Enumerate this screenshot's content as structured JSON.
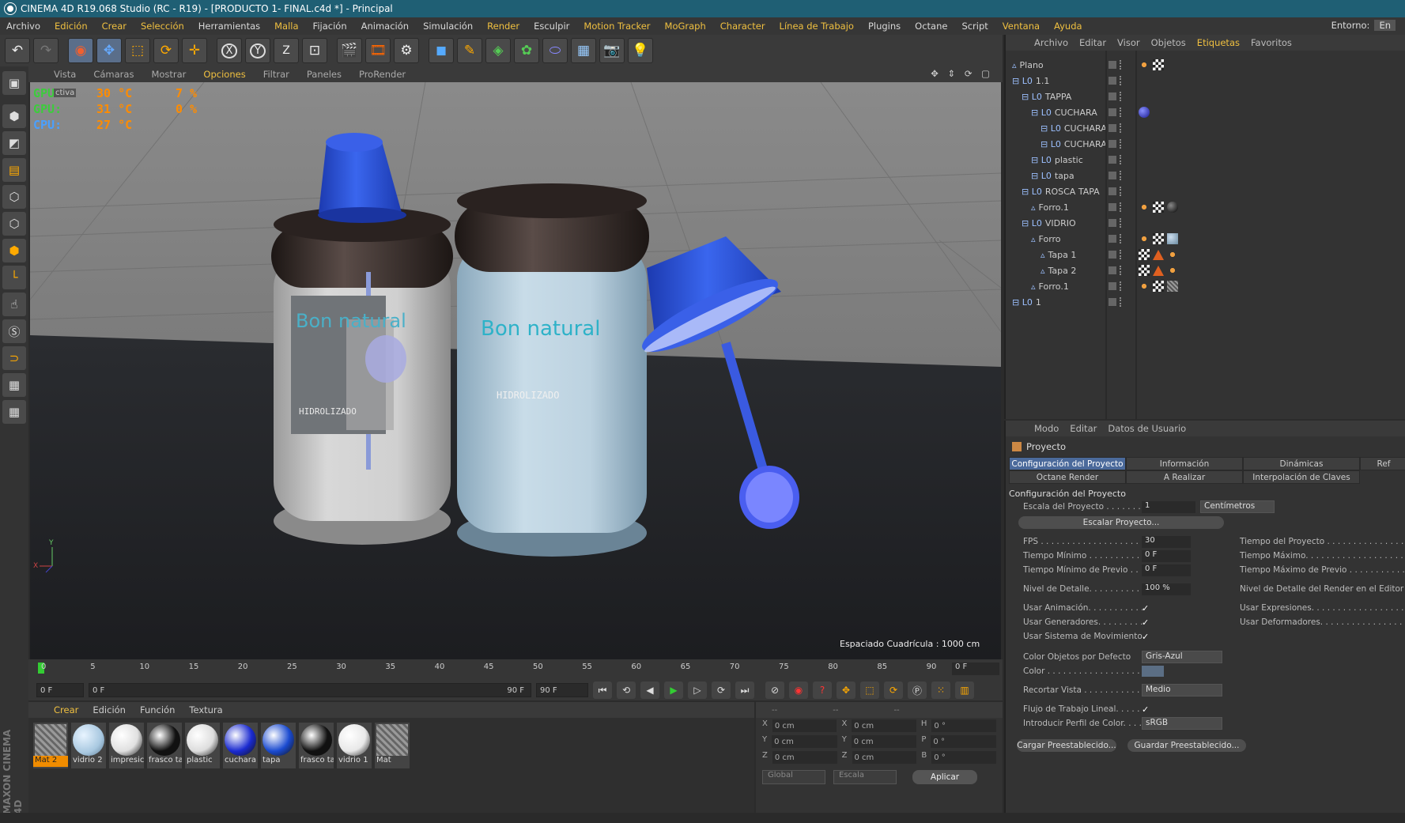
{
  "window": {
    "title": "CINEMA 4D R19.068 Studio (RC - R19) - [PRODUCTO 1- FINAL.c4d *] - Principal"
  },
  "menu": {
    "items": [
      "Archivo",
      "Edición",
      "Crear",
      "Selección",
      "Herramientas",
      "Malla",
      "Fijación",
      "Animación",
      "Simulación",
      "Render",
      "Esculpir",
      "Motion Tracker",
      "MoGraph",
      "Character",
      "Línea de Trabajo",
      "Plugins",
      "Octane",
      "Script",
      "Ventana",
      "Ayuda"
    ],
    "env_label": "Entorno:",
    "env_value": "En"
  },
  "toolbar": {
    "icons": [
      "undo-icon",
      "redo-icon",
      "live-select-icon",
      "move-icon",
      "scale-icon",
      "rotate-icon",
      "last-tool-icon",
      "x-axis-icon",
      "y-axis-icon",
      "z-axis-icon",
      "coordinate-system-icon",
      "render-view-icon",
      "render-picture-viewer-icon",
      "render-settings-icon",
      "cube-icon",
      "pen-icon",
      "subdivision-icon",
      "cloner-icon",
      "deformer-icon",
      "floor-icon",
      "camera-icon",
      "light-icon"
    ],
    "axis_x": "X",
    "axis_y": "Y",
    "axis_z": "Z"
  },
  "viewport": {
    "menu": [
      "Vista",
      "Cámaras",
      "Mostrar",
      "Opciones",
      "Filtrar",
      "Paneles",
      "ProRender"
    ],
    "active_menu": "Opciones",
    "stats": [
      {
        "label": "GPU:",
        "value": "30 °C",
        "extra": "7 %"
      },
      {
        "label": "GPU:",
        "value": "31 °C",
        "extra": "0 %"
      },
      {
        "label": "CPU:",
        "value": "27 °C",
        "extra": ""
      }
    ],
    "grid_spacing": "Espaciado Cuadrícula : 1000 cm",
    "brand_text": "Bon natural",
    "label_text": "HIDROLIZADO",
    "overlay_fragment": "ctiva"
  },
  "timeline": {
    "ticks": [
      "0",
      "5",
      "10",
      "15",
      "20",
      "25",
      "30",
      "35",
      "40",
      "45",
      "50",
      "55",
      "60",
      "65",
      "70",
      "75",
      "80",
      "85",
      "90"
    ],
    "current_frame": "0 F",
    "start_frame": "0 F",
    "range_start": "0 F",
    "range_end": "90 F",
    "end_frame": "90 F"
  },
  "materials": {
    "menu": [
      "Crear",
      "Edición",
      "Función",
      "Textura"
    ],
    "items": [
      {
        "name": "Mat 2",
        "color": "#7a7a7a",
        "style": "hatch",
        "selected": true
      },
      {
        "name": "vidrio 2",
        "color": "#a8c8e0",
        "style": "glass"
      },
      {
        "name": "impresic",
        "color": "#e0e0e0",
        "style": "white"
      },
      {
        "name": "frasco ta",
        "color": "#111111",
        "style": "black"
      },
      {
        "name": "plastic",
        "color": "#dddddd",
        "style": "white"
      },
      {
        "name": "cuchara",
        "color": "#1a2ad0",
        "style": "blue"
      },
      {
        "name": "tapa",
        "color": "#1a4ad0",
        "style": "blue"
      },
      {
        "name": "frasco ta",
        "color": "#111111",
        "style": "black"
      },
      {
        "name": "vidrio 1",
        "color": "#e8e8e8",
        "style": "white"
      },
      {
        "name": "Mat",
        "color": "#7a7a7a",
        "style": "hatch"
      }
    ]
  },
  "coordinates": {
    "header": [
      "--",
      "--",
      "--"
    ],
    "rows": [
      {
        "a": "X",
        "av": "0 cm",
        "b": "X",
        "bv": "0 cm",
        "c": "H",
        "cv": "0 °"
      },
      {
        "a": "Y",
        "av": "0 cm",
        "b": "Y",
        "bv": "0 cm",
        "c": "P",
        "cv": "0 °"
      },
      {
        "a": "Z",
        "av": "0 cm",
        "b": "Z",
        "bv": "0 cm",
        "c": "B",
        "cv": "0 °"
      }
    ],
    "mode1": "Global",
    "mode2": "Escala",
    "apply": "Aplicar"
  },
  "objects": {
    "menu": [
      "Archivo",
      "Editar",
      "Visor",
      "Objetos",
      "Etiquetas",
      "Favoritos"
    ],
    "active_menu": "Etiquetas",
    "tree": [
      {
        "name": "Plano",
        "depth": 0,
        "type": "poly",
        "tags": [
          "phong",
          "checker"
        ]
      },
      {
        "name": "1.1",
        "depth": 0,
        "type": "null",
        "tags": []
      },
      {
        "name": "TAPPA",
        "depth": 1,
        "type": "null",
        "tags": []
      },
      {
        "name": "CUCHARA",
        "depth": 2,
        "type": "null",
        "tags": [
          "ball-blue"
        ]
      },
      {
        "name": "CUCHARA",
        "depth": 3,
        "type": "null",
        "tags": []
      },
      {
        "name": "CUCHARA",
        "depth": 3,
        "type": "null",
        "tags": []
      },
      {
        "name": "plastic",
        "depth": 2,
        "type": "null",
        "tags": []
      },
      {
        "name": "tapa",
        "depth": 2,
        "type": "null",
        "tags": []
      },
      {
        "name": "ROSCA TAPA",
        "depth": 1,
        "type": "null",
        "tags": []
      },
      {
        "name": "Forro.1",
        "depth": 2,
        "type": "poly",
        "tags": [
          "phong",
          "checker",
          "ball-black"
        ]
      },
      {
        "name": "VIDRIO",
        "depth": 1,
        "type": "null",
        "tags": []
      },
      {
        "name": "Forro",
        "depth": 2,
        "type": "poly",
        "tags": [
          "phong",
          "checker",
          "ball-glass"
        ]
      },
      {
        "name": "Tapa 1",
        "depth": 3,
        "type": "poly",
        "tags": [
          "checker",
          "tri",
          "phong"
        ]
      },
      {
        "name": "Tapa 2",
        "depth": 3,
        "type": "poly",
        "tags": [
          "checker",
          "tri",
          "phong"
        ]
      },
      {
        "name": "Forro.1",
        "depth": 2,
        "type": "poly",
        "tags": [
          "phong",
          "checker",
          "hatch"
        ]
      },
      {
        "name": "1",
        "depth": 0,
        "type": "null",
        "tags": []
      }
    ]
  },
  "attributes": {
    "menu": [
      "Modo",
      "Editar",
      "Datos de Usuario"
    ],
    "object": "Proyecto",
    "tabs": [
      "Configuración del Proyecto",
      "Información",
      "Dinámicas",
      "Ref",
      "Octane Render",
      "A Realizar",
      "Interpolación de Claves"
    ],
    "section_title": "Configuración del Proyecto",
    "scale_label": "Escala del Proyecto . . . . . . . .",
    "scale_value": "1",
    "scale_unit": "Centímetros",
    "scale_button": "Escalar Proyecto...",
    "fps_label": "FPS . . . . . . . . . . . . . . . . . . . .",
    "fps_value": "30",
    "project_time_label": "Tiempo del Proyecto . . . . . . . . . . . . . . .",
    "min_time_label": "Tiempo Mínimo . . . . . . . . . . .",
    "min_time_value": "0 F",
    "max_time_label": "Tiempo Máximo. . . . . . . . . . . . . . . . . . .",
    "min_preview_label": "Tiempo Mínimo de Previo . .",
    "min_preview_value": "0 F",
    "max_preview_label": "Tiempo Máximo de Previo . . . . . . . . . . . .",
    "lod_label": "Nivel de Detalle. . . . . . . . . . . .",
    "lod_value": "100 %",
    "render_lod_label": "Nivel de Detalle del Render en el Editor",
    "use_anim_label": "Usar Animación. . . . . . . . . . .",
    "use_expr_label": "Usar Expresiones. . . . . . . . . . . . . . . . . . .",
    "use_gen_label": "Usar Generadores. . . . . . . . .",
    "use_def_label": "Usar Deformadores. . . . . . . . . . . . . . . . .",
    "use_motion_label": "Usar Sistema de Movimiento",
    "default_color_label": "Color Objetos por Defecto",
    "default_color_value": "Gris-Azul",
    "color_label": "Color . . . . . . . . . . . . . . . . . . .",
    "crop_label": "Recortar Vista . . . . . . . . . . . .",
    "crop_value": "Medio",
    "linear_label": "Flujo de Trabajo Lineal. . . . .",
    "profile_label": "Introducir Perfil de Color. . . .",
    "profile_value": "sRGB",
    "load_preset": "Cargar Preestablecido...",
    "save_preset": "Guardar Preestablecido...",
    "check": "✓"
  },
  "colors": {
    "title_bar": "#1f5f74",
    "accent_yellow": "#f0c040",
    "selected_tab": "#4b6a9b",
    "bottle_cap_blue": "#2a55d8",
    "bottle_dark": "#3a2c28"
  }
}
